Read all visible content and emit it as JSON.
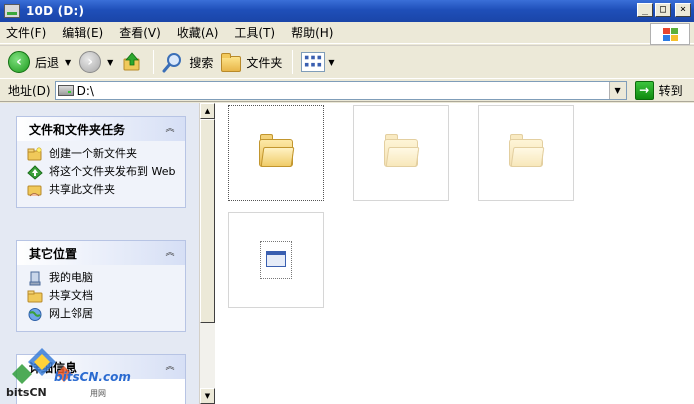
{
  "window": {
    "title": "10D (D:)",
    "minimize": "_",
    "maximize": "□",
    "close": "×"
  },
  "menu": [
    {
      "label": "文件(F)"
    },
    {
      "label": "编辑(E)"
    },
    {
      "label": "查看(V)"
    },
    {
      "label": "收藏(A)"
    },
    {
      "label": "工具(T)"
    },
    {
      "label": "帮助(H)"
    }
  ],
  "toolbar": {
    "back": "后退",
    "search": "搜索",
    "folders": "文件夹"
  },
  "address": {
    "label": "地址(D)",
    "value": "D:\\",
    "go": "转到"
  },
  "tasks": {
    "file_folder_title": "文件和文件夹任务",
    "items": [
      {
        "label": "创建一个新文件夹"
      },
      {
        "label": "将这个文件夹发布到 Web"
      },
      {
        "label": "共享此文件夹"
      }
    ]
  },
  "places": {
    "title": "其它位置",
    "items": [
      {
        "label": "我的电脑"
      },
      {
        "label": "共享文档"
      },
      {
        "label": "网上邻居"
      }
    ]
  },
  "details": {
    "title": "详细信息"
  },
  "watermark": {
    "brand": "bitsCN.com",
    "site": "bitsCN",
    "suffix": "用网"
  },
  "colors": {
    "titlebar": "#1f4fb9",
    "taskpane": "#e4e9f3",
    "folder": "#e9bd55",
    "accent_green": "#1e9a1e"
  }
}
